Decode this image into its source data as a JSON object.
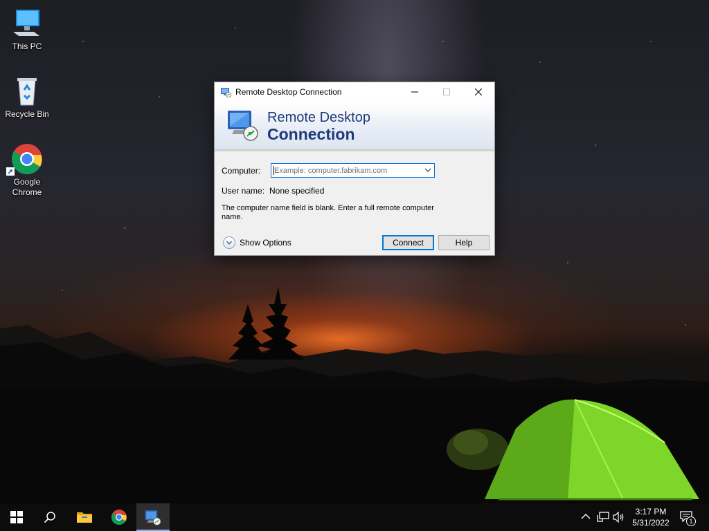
{
  "desktop": {
    "icons": [
      {
        "label": "This PC",
        "icon": "this-pc-icon"
      },
      {
        "label": "Recycle Bin",
        "icon": "recycle-bin-icon"
      },
      {
        "label": "Google Chrome",
        "icon": "chrome-icon"
      }
    ]
  },
  "dialog": {
    "title": "Remote Desktop Connection",
    "banner_line1": "Remote Desktop",
    "banner_line2": "Connection",
    "computer_label": "Computer:",
    "computer_value": "",
    "computer_placeholder": "Example: computer.fabrikam.com",
    "username_label": "User name:",
    "username_value": "None specified",
    "message": "The computer name field is blank. Enter a full remote computer name.",
    "show_options_label": "Show Options",
    "connect_label": "Connect",
    "help_label": "Help",
    "window_controls": [
      "minimize-icon",
      "maximize-icon",
      "close-icon"
    ]
  },
  "taskbar": {
    "items": [
      {
        "name": "start-button",
        "icon": "windows-logo-icon"
      },
      {
        "name": "search-button",
        "icon": "search-icon"
      },
      {
        "name": "file-explorer",
        "icon": "folder-icon"
      },
      {
        "name": "chrome",
        "icon": "chrome-icon"
      },
      {
        "name": "remote-desktop",
        "icon": "remote-desktop-icon",
        "active": true
      }
    ],
    "tray": {
      "icons": [
        "chevron-up-icon",
        "network-icon",
        "volume-icon"
      ],
      "time": "3:17 PM",
      "date": "5/31/2022",
      "notification_count": "1"
    }
  },
  "colors": {
    "banner_text": "#1e3a7a",
    "focus_border": "#0078d7",
    "taskbar": "#0c0c0e",
    "tent_green": "#8fe02a"
  }
}
